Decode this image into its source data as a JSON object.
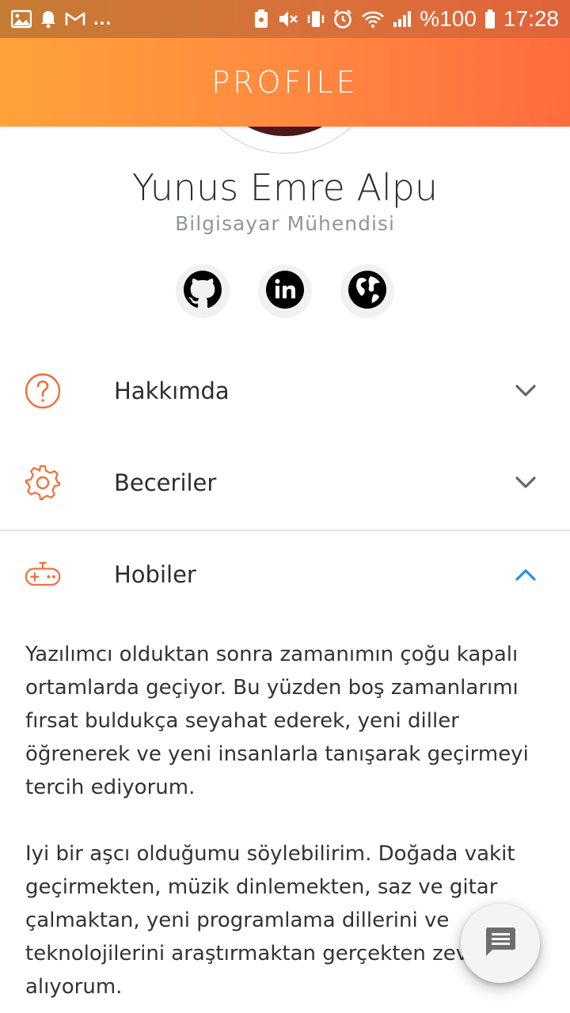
{
  "status_bar": {
    "left_icons": [
      "image-icon",
      "bell-icon",
      "gmail-icon"
    ],
    "more": "...",
    "right_icons": [
      "android-battery-saver-icon",
      "mute-icon",
      "vibrate-icon",
      "alarm-icon",
      "wifi-icon",
      "signal-icon"
    ],
    "battery": "%100",
    "time": "17:28"
  },
  "header": {
    "title": "PROFILE"
  },
  "profile": {
    "name": "Yunus Emre Alpu",
    "title": "Bilgisayar Mühendisi"
  },
  "socials": [
    {
      "icon": "github-icon"
    },
    {
      "icon": "linkedin-icon"
    },
    {
      "icon": "globe-icon"
    }
  ],
  "accordion": [
    {
      "label": "Hakkımda",
      "icon": "help-circle-icon",
      "expanded": false
    },
    {
      "label": "Beceriler",
      "icon": "gear-icon",
      "expanded": false
    },
    {
      "label": "Hobiler",
      "icon": "gamepad-icon",
      "expanded": true
    }
  ],
  "hobbies_text": {
    "p1": "Yazılımcı olduktan sonra zamanımın çoğu kapalı ortamlarda geçiyor. Bu yüzden boş zamanlarımı fırsat buldukça seyahat ederek, yeni diller öğrenerek ve yeni insanlarla tanışarak geçirmeyi tercih ediyorum.",
    "p2": "Iyi bir aşcı olduğumu söylebilirim. Doğada vakit geçirmekten, müzik dinlemekten, saz ve gitar çalmaktan, yeni programlama dillerini ve teknolojilerini araştırmaktan gerçekten zevk alıyorum."
  },
  "fab": {
    "icon": "chat-icon"
  },
  "colors": {
    "accent": "#f0703a",
    "header_start": "#ffa23a",
    "header_end": "#ff6b3d",
    "expanded_chevron": "#2b8fd6"
  }
}
